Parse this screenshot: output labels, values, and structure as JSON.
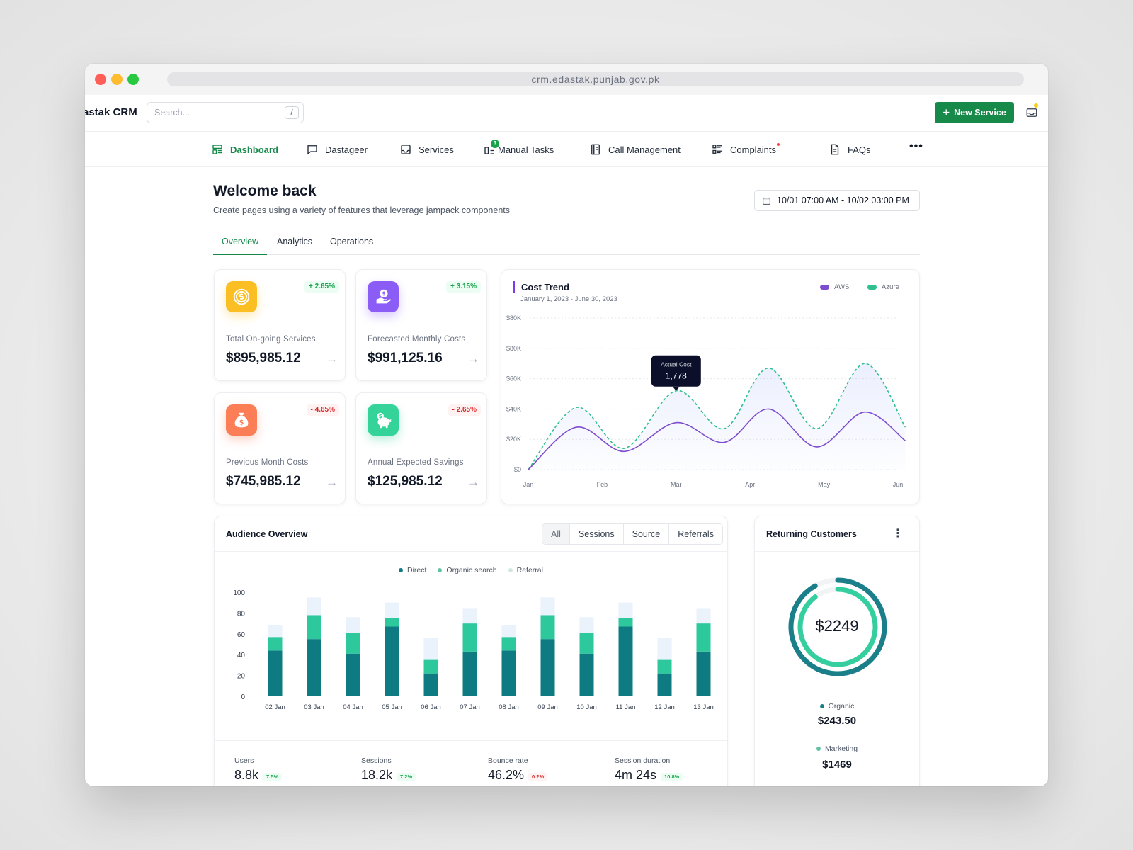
{
  "browser": {
    "url": "crm.edastak.punjab.gov.pk"
  },
  "app": {
    "brand": "astak CRM",
    "search_placeholder": "Search...",
    "search_shortcut": "/",
    "new_service_label": "New Service"
  },
  "nav": [
    {
      "label": "Dashboard",
      "icon": "dashboard-icon",
      "active": true
    },
    {
      "label": "Dastageer",
      "icon": "chat-icon"
    },
    {
      "label": "Services",
      "icon": "inbox-icon"
    },
    {
      "label": "Manual Tasks",
      "icon": "tasks-icon",
      "badge": "3"
    },
    {
      "label": "Call Management",
      "icon": "book-icon"
    },
    {
      "label": "Complaints",
      "icon": "list-icon"
    },
    {
      "label": "FAQs",
      "icon": "document-icon"
    }
  ],
  "page": {
    "title": "Welcome back",
    "subtitle": "Create pages using a variety of features that leverage jampack components",
    "date_range": "10/01 07:00 AM - 10/02 03:00 PM",
    "tabs": [
      "Overview",
      "Analytics",
      "Operations"
    ]
  },
  "stats": [
    {
      "label": "Total On-going Services",
      "value": "$895,985.12",
      "change": "+ 2.65%",
      "trend": "up",
      "color": "#fbbf24",
      "icon": "coin-icon"
    },
    {
      "label": "Forecasted Monthly Costs",
      "value": "$991,125.16",
      "change": "+ 3.15%",
      "trend": "up",
      "color": "#8b5cf6",
      "icon": "money-hand-icon"
    },
    {
      "label": "Previous Month Costs",
      "value": "$745,985.12",
      "change": "- 4.65%",
      "trend": "down",
      "color": "#fb7e57",
      "icon": "money-bag-icon"
    },
    {
      "label": "Annual Expected Savings",
      "value": "$125,985.12",
      "change": "- 2.65%",
      "trend": "down",
      "color": "#34d399",
      "icon": "piggy-bank-icon"
    }
  ],
  "cost_trend": {
    "title": "Cost Trend",
    "subtitle": "January 1, 2023 - June 30, 2023",
    "tooltip": {
      "label": "Actual Cost",
      "value": "1,778"
    },
    "chart_data": {
      "type": "line",
      "x": [
        "Jan",
        "Feb",
        "Mar",
        "Apr",
        "May",
        "Jun"
      ],
      "y_ticks": [
        "$0",
        "$20K",
        "$40K",
        "$60K",
        "$80K",
        "$80K"
      ],
      "ylim": [
        0,
        100000
      ],
      "grid": true,
      "legend_position": "top-right",
      "series": [
        {
          "name": "AWS",
          "color": "#7c4dcc",
          "points": [
            [
              0,
              0
            ],
            [
              0.65,
              28000
            ],
            [
              1.3,
              12000
            ],
            [
              2,
              31000
            ],
            [
              2.65,
              18000
            ],
            [
              3.25,
              40000
            ],
            [
              3.9,
              15000
            ],
            [
              4.55,
              38000
            ],
            [
              5.1,
              19000
            ]
          ]
        },
        {
          "name": "Azure",
          "color": "#2fc08f",
          "points": [
            [
              0,
              0
            ],
            [
              0.65,
              41000
            ],
            [
              1.3,
              14000
            ],
            [
              2,
              52000
            ],
            [
              2.65,
              27000
            ],
            [
              3.25,
              67000
            ],
            [
              3.9,
              27000
            ],
            [
              4.55,
              70000
            ],
            [
              5.1,
              28000
            ]
          ]
        }
      ]
    }
  },
  "audience": {
    "title": "Audience Overview",
    "filters": [
      "All",
      "Sessions",
      "Source",
      "Referrals"
    ],
    "active_filter": "All",
    "chart_data": {
      "type": "bar",
      "stacked": true,
      "categories": [
        "02 Jan",
        "03 Jan",
        "04 Jan",
        "05 Jan",
        "06 Jan",
        "07 Jan",
        "08 Jan",
        "09 Jan",
        "10 Jan",
        "11 Jan",
        "12 Jan",
        "13 Jan"
      ],
      "y_ticks": [
        "0",
        "20",
        "40",
        "60",
        "80",
        "100"
      ],
      "ylim": [
        0,
        100
      ],
      "legend_position": "top-center",
      "series": [
        {
          "name": "Direct",
          "color": "#0e7b83",
          "values": [
            44,
            55,
            41,
            67,
            22,
            43,
            44,
            55,
            41,
            67,
            22,
            43
          ]
        },
        {
          "name": "Organic search",
          "color": "#2ec89d",
          "values": [
            13,
            23,
            20,
            8,
            13,
            27,
            13,
            23,
            20,
            8,
            13,
            27
          ]
        },
        {
          "name": "Referral",
          "color": "#eaf2fc",
          "values": [
            11,
            17,
            15,
            15,
            21,
            14,
            11,
            17,
            15,
            15,
            21,
            14
          ]
        }
      ]
    },
    "kpis": [
      {
        "label": "Users",
        "value": "8.8k",
        "change": "7.5%",
        "trend": "up"
      },
      {
        "label": "Sessions",
        "value": "18.2k",
        "change": "7.2%",
        "trend": "up"
      },
      {
        "label": "Bounce rate",
        "value": "46.2%",
        "change": "0.2%",
        "trend": "down"
      },
      {
        "label": "Session duration",
        "value": "4m 24s",
        "change": "10.8%",
        "trend": "up"
      }
    ]
  },
  "returning": {
    "title": "Returning Customers",
    "total": "$2249",
    "chart_data": {
      "type": "pie",
      "variant": "radial",
      "series": [
        {
          "name": "Organic",
          "value": 243.5,
          "color": "#1b7f8a"
        },
        {
          "name": "Marketing",
          "value": 1469,
          "color": "#35cf9f"
        }
      ]
    },
    "items": [
      {
        "label": "Organic",
        "value": "$243.50",
        "color": "#1b7f8a"
      },
      {
        "label": "Marketing",
        "value": "$1469",
        "color": "#5fc3a3"
      }
    ]
  }
}
